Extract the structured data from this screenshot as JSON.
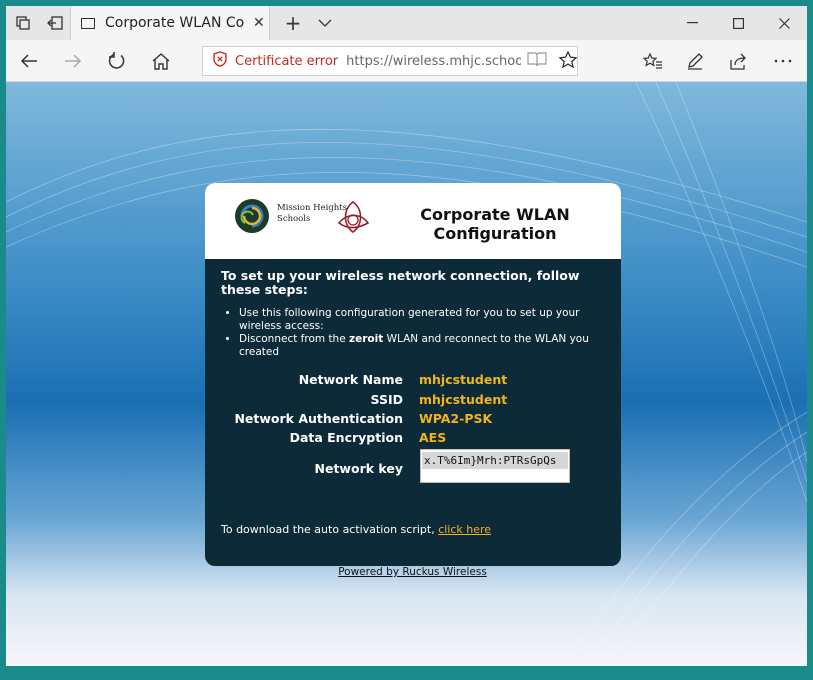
{
  "browser": {
    "tab_title": "Corporate WLAN Config",
    "cert_error": "Certificate error",
    "url": "https://wireless.mhjc.school.nz/user,"
  },
  "header": {
    "logo_text_line1": "Mission Heights",
    "logo_text_line2": "Schools",
    "title_line1": "Corporate WLAN",
    "title_line2": "Configuration"
  },
  "body": {
    "intro": "To set up your wireless network connection, follow these steps:",
    "step1": "Use this following configuration generated for you to set up your wireless access:",
    "step2_pre": "Disconnect from the ",
    "step2_bold": "zeroit",
    "step2_post": " WLAN and reconnect to the WLAN you created"
  },
  "config": {
    "network_name_label": "Network Name",
    "network_name_value": "mhjcstudent",
    "ssid_label": "SSID",
    "ssid_value": "mhjcstudent",
    "auth_label": "Network Authentication",
    "auth_value": "WPA2-PSK",
    "enc_label": "Data Encryption",
    "enc_value": "AES",
    "key_label": "Network key",
    "key_value": "x.T%6Im}Mrh:PTRsGpQs"
  },
  "download": {
    "text": "To download the auto activation script, ",
    "link": "click here"
  },
  "footer": {
    "powered": "Powered by Ruckus Wireless"
  },
  "colors": {
    "accent": "#f2b41b",
    "card_bg": "#0c2a38",
    "cert_error": "#c42b1c",
    "frame": "#1b8a8a"
  }
}
